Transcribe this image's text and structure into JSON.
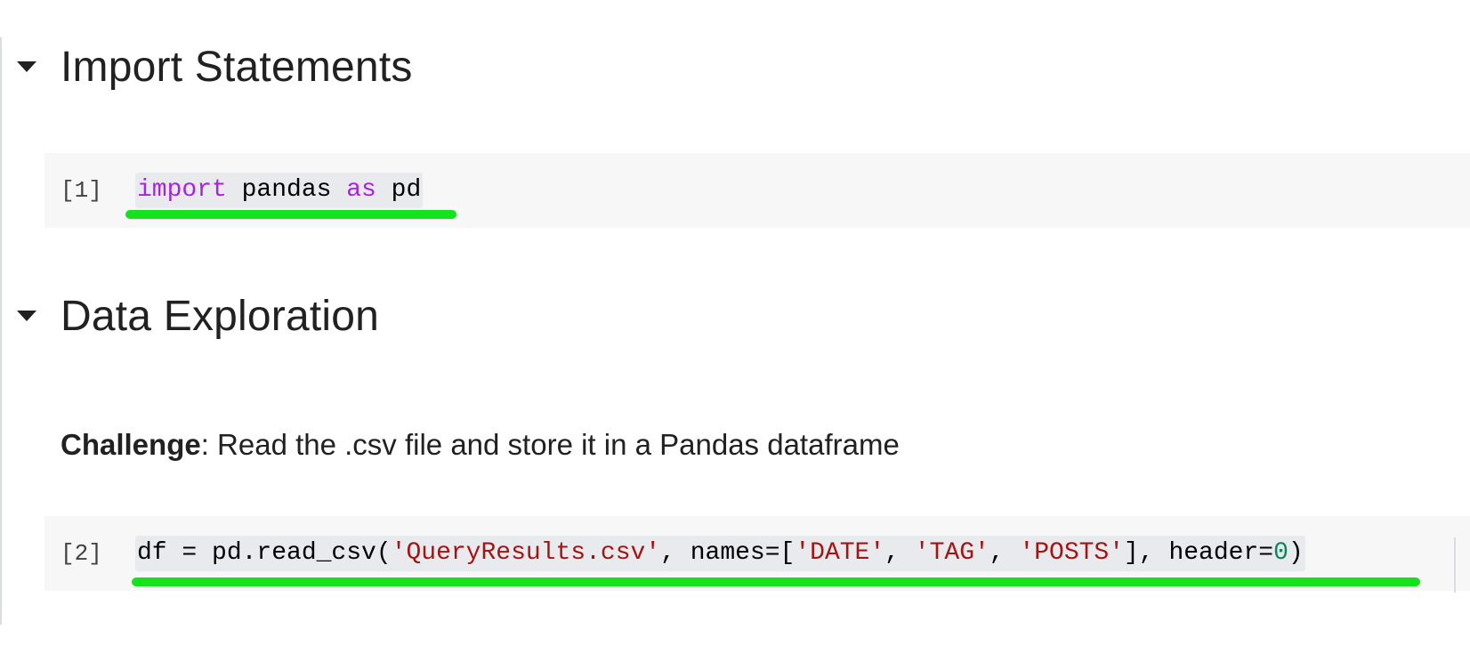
{
  "sections": [
    {
      "title": "Import Statements",
      "toggle_icon": "caret-down-icon"
    },
    {
      "title": "Data Exploration",
      "toggle_icon": "caret-down-icon"
    }
  ],
  "cells": [
    {
      "exec_count": "[1]",
      "tokens": {
        "kw_import": "import",
        "pandas": " pandas ",
        "kw_as": "as",
        "alias": " pd"
      }
    },
    {
      "exec_count": "[2]",
      "tokens": {
        "call": "df = pd.read_csv(",
        "filename": "'QueryResults.csv'",
        "names_kw": ", names=[",
        "col_date": "'DATE'",
        "sep1": ", ",
        "col_tag": "'TAG'",
        "sep2": ", ",
        "col_posts": "'POSTS'",
        "header_kw": "], header=",
        "header_val": "0",
        "close": ")"
      }
    }
  ],
  "challenge": {
    "label": "Challenge",
    "text": ": Read the .csv file and store it in a Pandas dataframe"
  },
  "colors": {
    "keyword": "#a626d6",
    "string": "#a31515",
    "number": "#098658",
    "highlight_underline": "#13e31a",
    "cell_background": "#f7f7f7"
  }
}
